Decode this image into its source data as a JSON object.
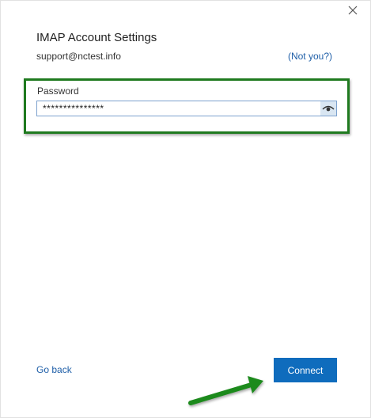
{
  "dialog": {
    "title": "IMAP Account Settings",
    "account_email": "support@nctest.info",
    "not_you_link": "(Not you?)"
  },
  "password": {
    "label": "Password",
    "value": "***************"
  },
  "footer": {
    "go_back_label": "Go back",
    "connect_label": "Connect"
  },
  "colors": {
    "accent": "#0f6cbd",
    "link": "#1f5fa8",
    "annotation": "#1f7a1f"
  },
  "icons": {
    "close": "close-icon",
    "reveal_password": "eye-icon",
    "annotation_arrow": "arrow-icon"
  }
}
